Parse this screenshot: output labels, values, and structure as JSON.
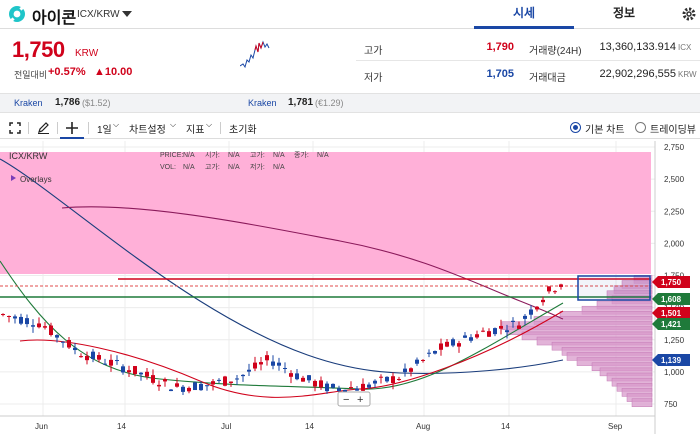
{
  "header": {
    "coin_name": "아이콘",
    "pair": "ICX/KRW",
    "tabs": [
      {
        "label": "시세",
        "active": true
      },
      {
        "label": "정보",
        "active": false
      }
    ]
  },
  "price": {
    "value": "1,750",
    "currency": "KRW",
    "change_label": "전일대비",
    "change_pct": "+0.57%",
    "change_abs": "▲10.00"
  },
  "stats": {
    "high_label": "고가",
    "high": "1,790",
    "low_label": "저가",
    "low": "1,705",
    "volume_label": "거래량(24H)",
    "volume": "13,360,133.914",
    "volume_unit": "ICX",
    "amount_label": "거래대금",
    "amount": "22,902,296,555",
    "amount_unit": "KRW"
  },
  "kraken": [
    {
      "name": "Kraken",
      "value": "1,786",
      "sub": "($1.52)"
    },
    {
      "name": "Kraken",
      "value": "1,781",
      "sub": "(€1.29)"
    }
  ],
  "toolbar": {
    "interval": "1일",
    "chart_settings": "차트설정",
    "indicators": "지표",
    "reset": "초기화",
    "basic_chart": "기본 차트",
    "tradingview": "트레이딩뷰"
  },
  "chart": {
    "symbol": "ICX/KRW",
    "overlays": "Overlays",
    "info_row1": [
      "PRICE:",
      "N/A",
      "시가:",
      "N/A",
      "고가:",
      "N/A",
      "종가:",
      "N/A"
    ],
    "info_row2": [
      "VOL:",
      "N/A",
      "고가:",
      "N/A",
      "저가:",
      "N/A"
    ],
    "x_labels": [
      "Jun",
      "14",
      "Jul",
      "14",
      "Aug",
      "14",
      "Sep"
    ],
    "y_labels": [
      "2,750",
      "2,500",
      "2,250",
      "2,000",
      "1,750",
      "1,500",
      "1,250",
      "1,000",
      "750"
    ],
    "price_tags": [
      {
        "label": "1,750",
        "color": "#d0021b"
      },
      {
        "label": "1,608",
        "color": "#1f7a3a"
      },
      {
        "label": "1,501",
        "color": "#d0021b"
      },
      {
        "label": "1,421",
        "color": "#1f7a3a"
      },
      {
        "label": "1,139",
        "color": "#1a47a5"
      }
    ],
    "colors": {
      "up": "#d0021b",
      "down": "#1a47a5",
      "zone": "#ffb0d8",
      "profile": "#d89acb"
    }
  }
}
